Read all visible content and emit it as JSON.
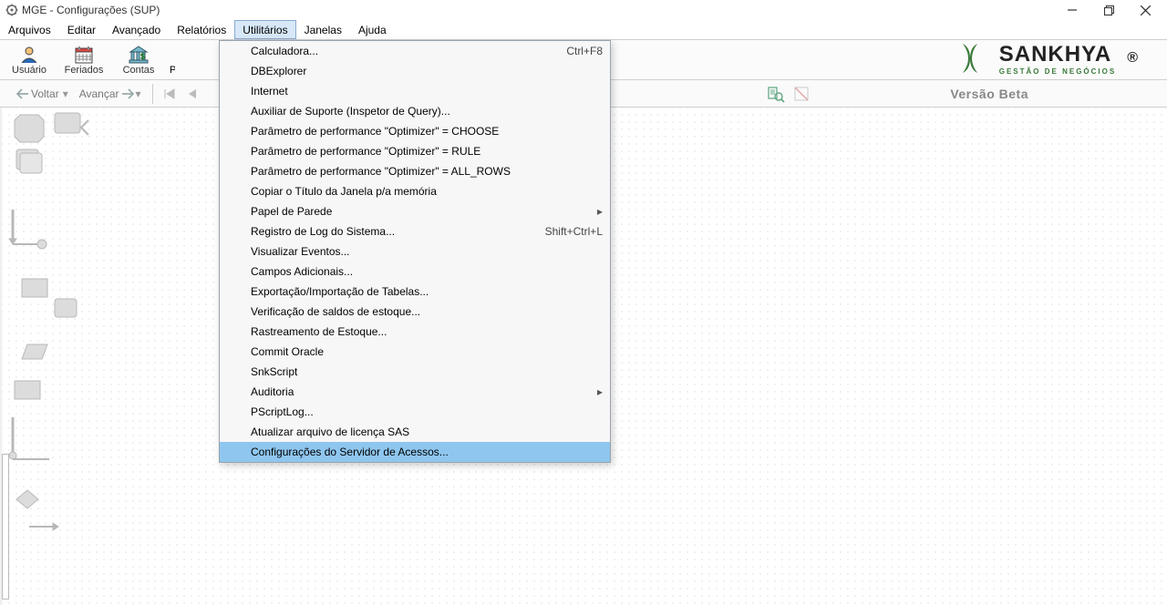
{
  "title": "MGE - Configurações (SUP)",
  "menubar": [
    "Arquivos",
    "Editar",
    "Avançado",
    "Relatórios",
    "Utilitários",
    "Janelas",
    "Ajuda"
  ],
  "menubar_open_index": 4,
  "toolbar": {
    "items": [
      "Usuário",
      "Feriados",
      "Contas"
    ],
    "partial": "P"
  },
  "navbar": {
    "back": "Voltar",
    "forward": "Avançar"
  },
  "version_text": "Versão Beta",
  "logo": {
    "brand": "SANKHYA",
    "tagline": "GESTÃO DE NEGÓCIOS"
  },
  "dropdown": {
    "highlight_index": 20,
    "items": [
      {
        "label": "Calculadora...",
        "shortcut": "Ctrl+F8"
      },
      {
        "label": "DBExplorer"
      },
      {
        "label": "Internet"
      },
      {
        "label": "Auxiliar de Suporte (Inspetor de Query)..."
      },
      {
        "label": "Parâmetro de performance \"Optimizer\" = CHOOSE"
      },
      {
        "label": "Parâmetro de performance \"Optimizer\" = RULE"
      },
      {
        "label": "Parâmetro de performance \"Optimizer\" = ALL_ROWS"
      },
      {
        "label": "Copiar o Título da Janela p/a memória"
      },
      {
        "label": "Papel de Parede",
        "submenu": true
      },
      {
        "label": "Registro de Log do Sistema...",
        "shortcut": "Shift+Ctrl+L"
      },
      {
        "label": "Visualizar Eventos..."
      },
      {
        "label": "Campos Adicionais..."
      },
      {
        "label": "Exportação/Importação de Tabelas..."
      },
      {
        "label": "Verificação de saldos de estoque..."
      },
      {
        "label": "Rastreamento de Estoque..."
      },
      {
        "label": "Commit Oracle"
      },
      {
        "label": "SnkScript"
      },
      {
        "label": "Auditoria",
        "submenu": true
      },
      {
        "label": "PScriptLog..."
      },
      {
        "label": "Atualizar arquivo de licença SAS"
      },
      {
        "label": "Configurações do Servidor de Acessos..."
      }
    ]
  }
}
